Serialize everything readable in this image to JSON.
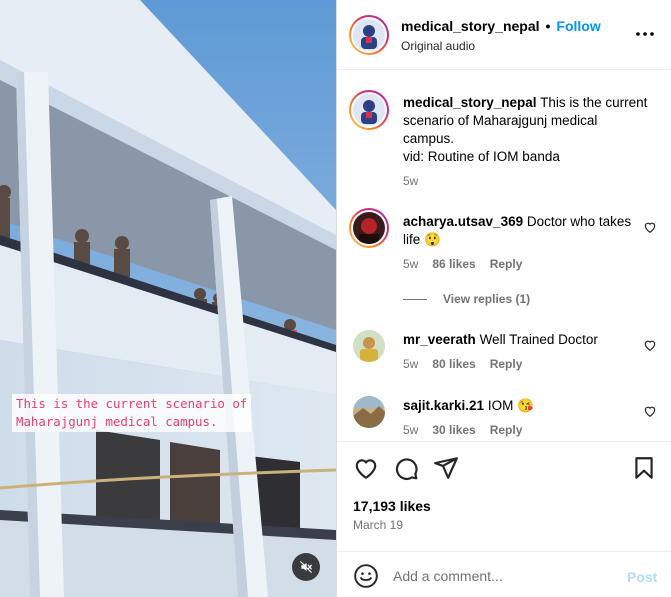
{
  "media": {
    "overlay_line1": "This is the current scenario of",
    "overlay_line2": "Maharajgunj medical campus.",
    "mute_icon": "speaker-muted-icon"
  },
  "header": {
    "username": "medical_story_nepal",
    "separator": "•",
    "follow_label": "Follow",
    "audio_label": "Original audio",
    "more_icon": "ellipsis-icon"
  },
  "post_caption": {
    "username": "medical_story_nepal",
    "text": "This is the current scenario of Maharajgunj medical campus.",
    "text2": "vid: Routine of IOM banda",
    "time": "5w"
  },
  "comments": [
    {
      "username": "acharya.utsav_369",
      "text": "Doctor who takes life 😲",
      "time": "5w",
      "likes": "86 likes",
      "reply": "Reply",
      "view_replies": "View replies (1)"
    },
    {
      "username": "mr_veerath",
      "text": "Well Trained Doctor",
      "time": "5w",
      "likes": "80 likes",
      "reply": "Reply"
    },
    {
      "username": "sajit.karki.21",
      "text": "IOM 😘",
      "time": "5w",
      "likes": "30 likes",
      "reply": "Reply"
    }
  ],
  "actions": {
    "likes": "17,193 likes",
    "date": "March 19",
    "comment_placeholder": "Add a comment...",
    "post_label": "Post"
  },
  "colors": {
    "accent": "#0095f6",
    "muted_text": "#737373",
    "overlay_text": "#e8406b",
    "post_disabled": "#b3dbff"
  }
}
